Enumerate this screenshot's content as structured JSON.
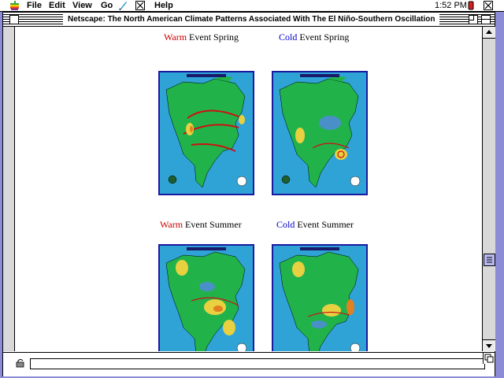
{
  "menubar": {
    "items": [
      "File",
      "Edit",
      "View",
      "Go",
      "Help"
    ],
    "clock": "1:52 PM"
  },
  "window": {
    "title": "Netscape: The North American Climate Patterns Associated With The El Niño-Southern Oscillation"
  },
  "content": {
    "sections": [
      {
        "left": {
          "kind": "Warm",
          "label": " Event Spring"
        },
        "right": {
          "kind": "Cold",
          "label": " Event Spring"
        }
      },
      {
        "left": {
          "kind": "Warm",
          "label": " Event Summer"
        },
        "right": {
          "kind": "Cold",
          "label": " Event Summer"
        }
      }
    ]
  },
  "colors": {
    "warm": "#cc0000",
    "cold": "#0000cc",
    "ocean": "#2fa3d6",
    "land": "#21b34a",
    "desktop": "#8c8cd6"
  },
  "icons": [
    "apple-menu-icon",
    "netscape-icon",
    "application-icon",
    "close-box-icon",
    "zoom-box-icon",
    "collapse-box-icon",
    "security-lock-icon"
  ]
}
